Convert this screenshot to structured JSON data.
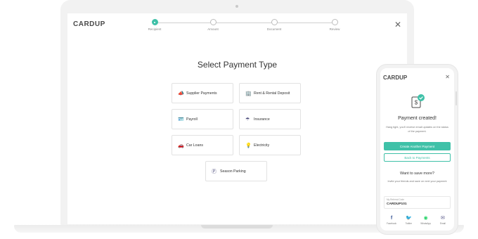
{
  "laptop": {
    "logo": "CARDUP",
    "close_glyph": "✕",
    "stepper": {
      "steps": [
        {
          "label": "Recipient",
          "active": true
        },
        {
          "label": "Amount",
          "active": false
        },
        {
          "label": "Document",
          "active": false
        },
        {
          "label": "Review",
          "active": false
        }
      ]
    },
    "title": "Select Payment Type",
    "payment_types": [
      {
        "label": "Supplier Payments",
        "icon": "megaphone-icon",
        "glyph": "📣"
      },
      {
        "label": "Rent & Rental Deposit",
        "icon": "building-icon",
        "glyph": "🏢"
      },
      {
        "label": "Payroll",
        "icon": "id-card-icon",
        "glyph": "🪪"
      },
      {
        "label": "Insurance",
        "icon": "umbrella-icon",
        "glyph": "☂"
      },
      {
        "label": "Car Loans",
        "icon": "car-icon",
        "glyph": "🚗"
      },
      {
        "label": "Electricity",
        "icon": "bulb-icon",
        "glyph": "💡"
      },
      {
        "label": "Season Parking",
        "icon": "parking-icon",
        "glyph": "Ⓟ"
      }
    ]
  },
  "phone": {
    "logo": "CARDUP",
    "close_glyph": "✕",
    "title": "Payment created!",
    "description": "Hang tight, you'll receive email updates on the status of the payment.",
    "primary_button": "Create Another Payment",
    "secondary_button": "Back to Payments",
    "save_title": "Want to save more?",
    "save_description": "Invite your friends and save on next your payment",
    "referral": {
      "label": "My Referral Code",
      "code": "CARDUP101"
    },
    "share": [
      {
        "label": "Facebook",
        "icon": "facebook-icon",
        "glyph": "f",
        "color": "#3b5998"
      },
      {
        "label": "Twitter",
        "icon": "twitter-icon",
        "glyph": "🐦",
        "color": "#1da1f2"
      },
      {
        "label": "WhatsApp",
        "icon": "whatsapp-icon",
        "glyph": "◉",
        "color": "#25d366"
      },
      {
        "label": "Email",
        "icon": "email-icon",
        "glyph": "✉",
        "color": "#5a5a8a"
      }
    ]
  },
  "colors": {
    "accent": "#3fc1a8"
  }
}
